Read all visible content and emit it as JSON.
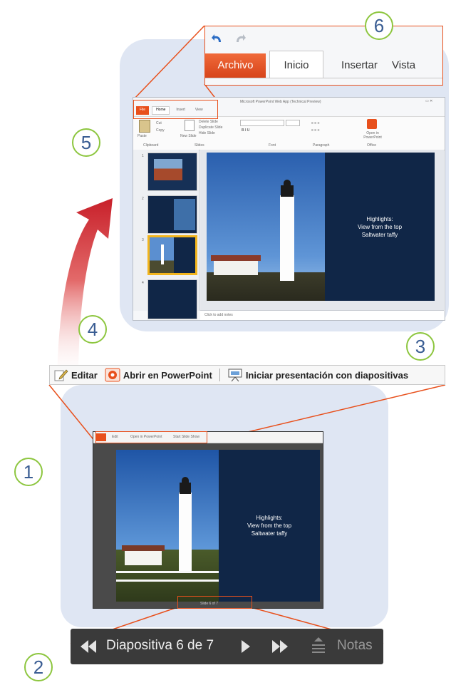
{
  "callouts": [
    "1",
    "2",
    "3",
    "4",
    "5",
    "6"
  ],
  "ribbon_zoom": {
    "tabs": [
      "Archivo",
      "Inicio",
      "Insertar",
      "Vista"
    ],
    "undo_icon": "undo-icon",
    "redo_icon": "redo-icon"
  },
  "editor": {
    "window_title": "Microsoft PowerPoint Web App (Technical Preview)",
    "mini_tabs": [
      "File",
      "Home",
      "Insert",
      "View"
    ],
    "ribbon_groups": [
      "Clipboard",
      "Slides",
      "Font",
      "Paragraph",
      "Office"
    ],
    "ribbon_labels": {
      "paste": "Paste",
      "cut": "Cut",
      "copy": "Copy",
      "new_slide": "New Slide",
      "delete_slide": "Delete Slide",
      "duplicate_slide": "Duplicate Slide",
      "hide_slide": "Hide Slide",
      "open_in_ppt": "Open in PowerPoint"
    },
    "slide_text": [
      "Highlights:",
      "View from the top",
      "Saltwater taffy"
    ],
    "notes_placeholder": "Click to add notes",
    "thumb_numbers": [
      "1",
      "2",
      "3",
      "4"
    ]
  },
  "toolbar": {
    "edit_label": "Editar",
    "open_label": "Abrir en PowerPoint",
    "slideshow_label": "Iniciar presentación con diapositivas"
  },
  "viewer": {
    "mini_toolbar": [
      "Edit",
      "Open in PowerPoint",
      "Start Slide Show"
    ],
    "slide_text": [
      "Highlights:",
      "View from the top",
      "Saltwater taffy"
    ],
    "mini_nav": "Slide 6 of 7"
  },
  "nav_bar": {
    "counter": "Diapositiva 6 de 7",
    "notes_label": "Notas"
  },
  "colors": {
    "accent_orange": "#e8501c",
    "panel": "#dfe6f3",
    "slide_navy": "#102647",
    "callout_green": "#8dc63f",
    "arrow_red": "#c8202a"
  }
}
